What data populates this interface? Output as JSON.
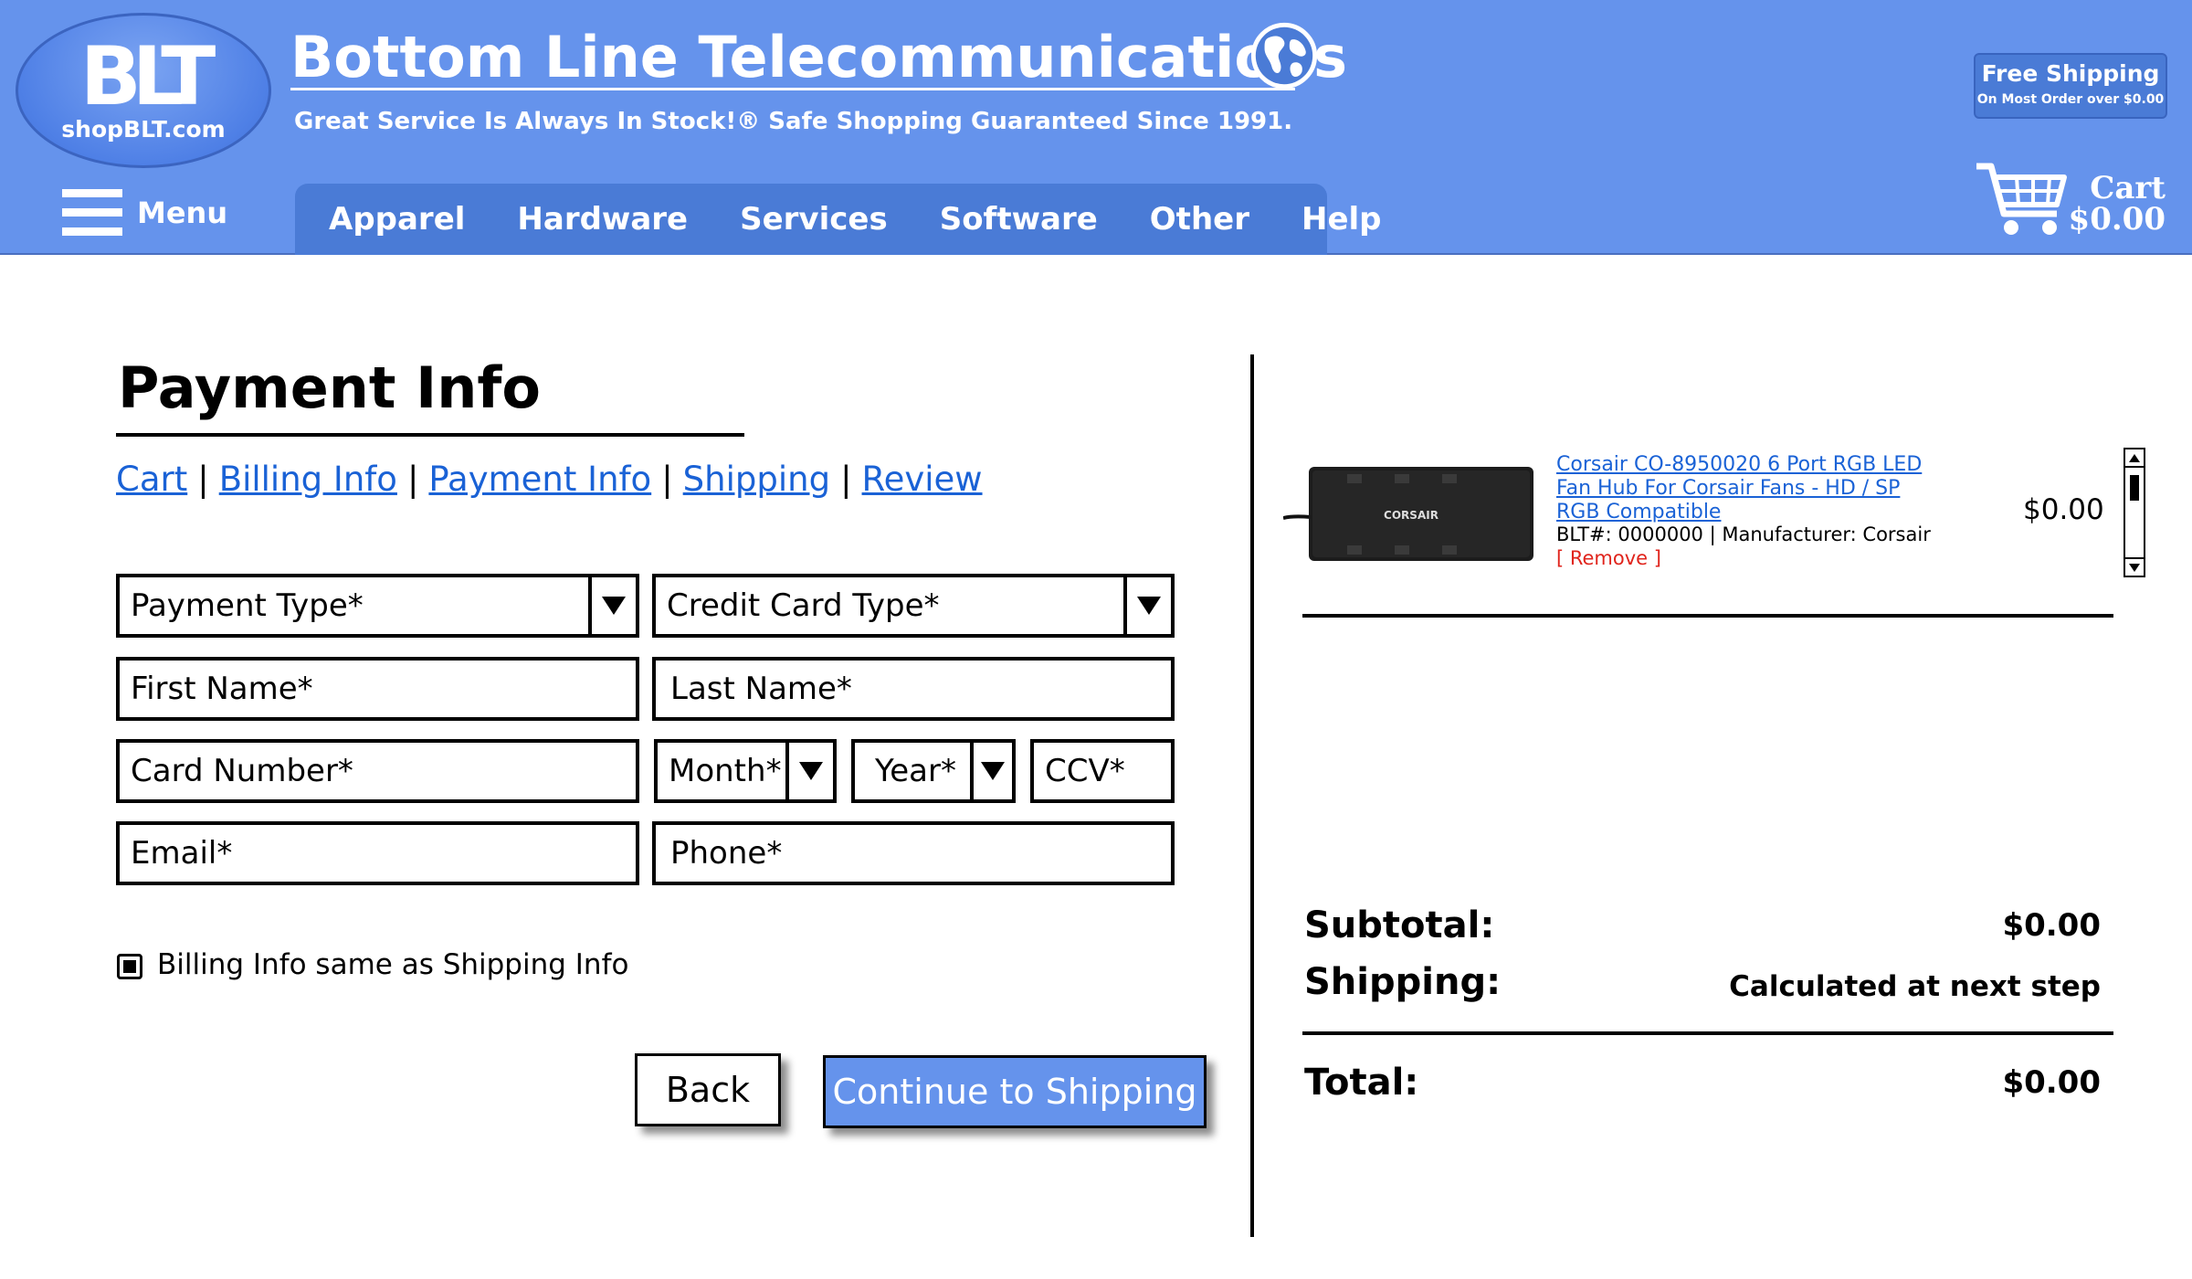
{
  "brand": {
    "logo_text": "BLT",
    "site": "shopBLT.com",
    "title": "Bottom Line Telecommunications",
    "tagline": "Great Service Is Always In Stock!® Safe Shopping Guaranteed Since 1991."
  },
  "menu": {
    "label": "Menu"
  },
  "nav": {
    "items": [
      "Apparel",
      "Hardware",
      "Services",
      "Software",
      "Other",
      "Help"
    ]
  },
  "free_shipping": {
    "title": "Free Shipping",
    "subtitle": "On Most Order over $0.00"
  },
  "cart": {
    "label": "Cart",
    "total": "$0.00"
  },
  "page": {
    "title": "Payment Info"
  },
  "steps": [
    "Cart",
    "Billing Info",
    "Payment Info",
    "Shipping",
    "Review"
  ],
  "form": {
    "payment_type": "Payment Type*",
    "credit_card_type": "Credit Card Type*",
    "first_name": "First Name*",
    "last_name": "Last Name*",
    "card_number": "Card Number*",
    "month": "Month*",
    "year": "Year*",
    "ccv": "CCV*",
    "email": "Email*",
    "phone": "Phone*",
    "billing_same_label": "Billing Info same as Shipping Info",
    "billing_same_checked": true
  },
  "buttons": {
    "back": "Back",
    "continue": "Continue to Shipping"
  },
  "order": {
    "item": {
      "name": "Corsair CO-8950020 6 Port RGB LED Fan Hub For Corsair Fans - HD / SP RGB Compatible",
      "meta": "BLT#: 0000000 | Manufacturer: Corsair",
      "remove": "[ Remove ]",
      "price": "$0.00",
      "image_brand": "CORSAIR"
    },
    "subtotal_label": "Subtotal:",
    "subtotal": "$0.00",
    "shipping_label": "Shipping:",
    "shipping": "Calculated at next step",
    "total_label": "Total:",
    "total": "$0.00"
  },
  "colors": {
    "header": "#6593ec",
    "nav": "#4a7bd6",
    "link": "#1a62d6",
    "remove": "#e0241c"
  }
}
